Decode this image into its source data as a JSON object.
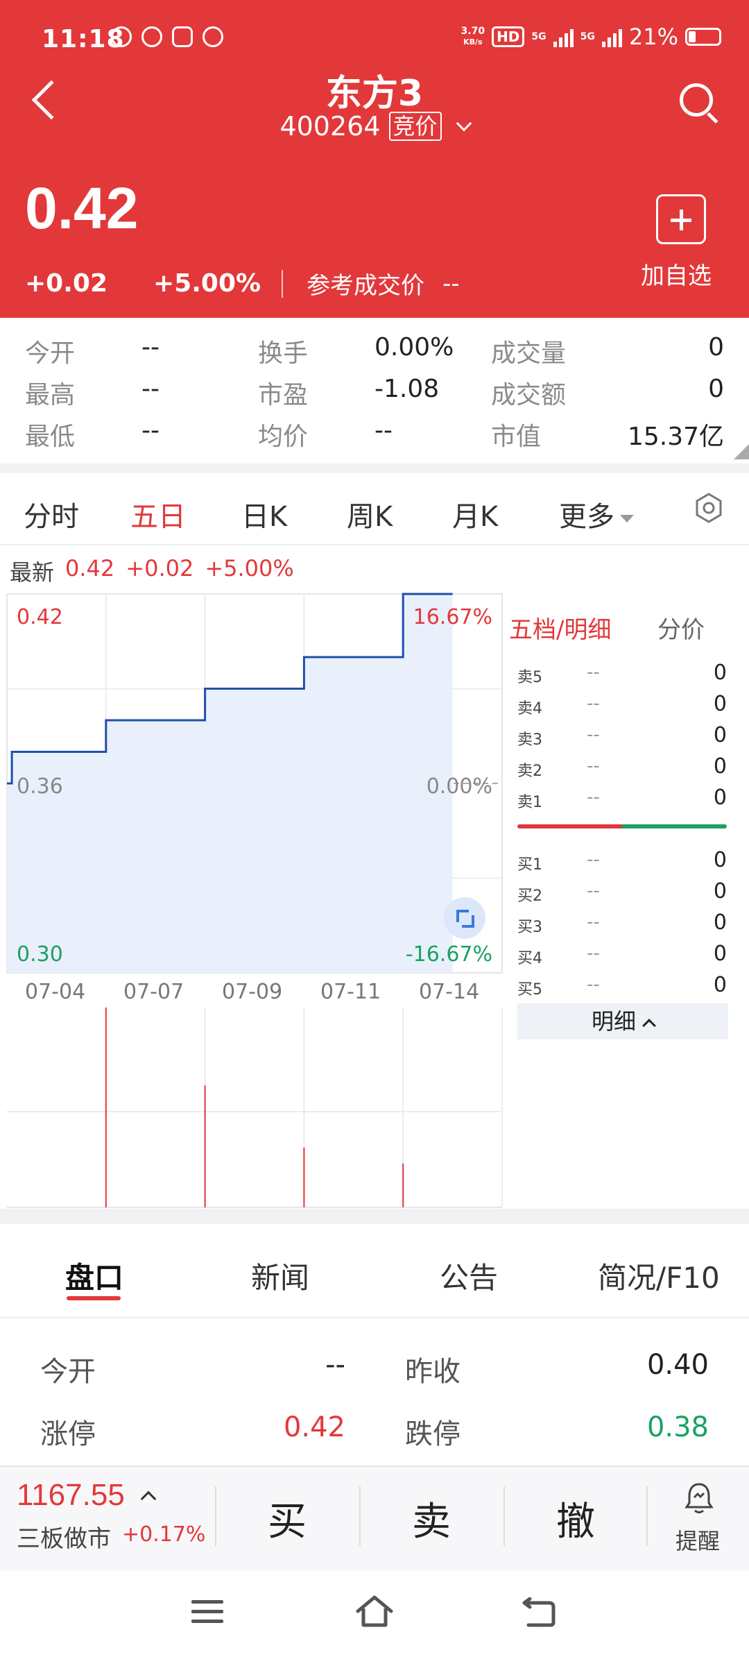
{
  "status_bar": {
    "time": "11:18",
    "net_speed_value": "3.70",
    "net_speed_unit": "KB/s",
    "hd": "HD",
    "signal_1": "5G",
    "signal_2": "5G",
    "battery": "21%"
  },
  "header": {
    "stock_name": "东方3",
    "stock_code": "400264",
    "code_badge": "竞价",
    "price": "0.42",
    "change": "+0.02",
    "change_pct": "+5.00%",
    "ref_label": "参考成交价",
    "ref_value": "--",
    "add_watch_label": "加自选",
    "colors": {
      "header_bg": "#e2383a",
      "up": "#e2383a",
      "down": "#1aa261"
    }
  },
  "stats": [
    {
      "label": "今开",
      "value": "--"
    },
    {
      "label": "换手",
      "value": "0.00%"
    },
    {
      "label": "成交量",
      "value": "0"
    },
    {
      "label": "最高",
      "value": "--"
    },
    {
      "label": "市盈",
      "value": "-1.08"
    },
    {
      "label": "成交额",
      "value": "0"
    },
    {
      "label": "最低",
      "value": "--"
    },
    {
      "label": "均价",
      "value": "--"
    },
    {
      "label": "市值",
      "value": "15.37亿"
    }
  ],
  "chart_tabs": [
    {
      "label": "分时"
    },
    {
      "label": "五日"
    },
    {
      "label": "日K"
    },
    {
      "label": "周K"
    },
    {
      "label": "月K"
    },
    {
      "label": "更多"
    }
  ],
  "active_chart_tab": "五日",
  "latest": {
    "label": "最新",
    "price": "0.42",
    "change": "+0.02",
    "pct": "+5.00%"
  },
  "chart_data": {
    "type": "line",
    "series": [
      {
        "values": [
          0.36,
          0.36,
          0.37,
          0.37,
          0.38,
          0.38,
          0.39,
          0.39,
          0.4,
          0.4,
          0.42,
          0.42
        ]
      }
    ],
    "x": [
      0,
      0.05,
      0.05,
      1,
      1,
      2,
      2,
      3,
      3,
      4,
      4,
      4.5
    ],
    "dates": [
      "07-04",
      "07-07",
      "07-09",
      "07-11",
      "07-14"
    ],
    "y_left_labels": {
      "top": "0.42",
      "mid": "0.36",
      "bottom": "0.30"
    },
    "y_right_labels": {
      "top": "16.67%",
      "mid": "0.00%",
      "bottom": "-16.67%"
    },
    "ylim": [
      0.3,
      0.42
    ],
    "volume": [
      {
        "day": 1,
        "rel": 1.0
      },
      {
        "day": 2,
        "rel": 0.61
      },
      {
        "day": 3,
        "rel": 0.3
      },
      {
        "day": 4,
        "rel": 0.22
      }
    ],
    "grid": true,
    "line_color": "#1f4fa8",
    "fill_color": "#e9f0fb"
  },
  "order_book": {
    "tab_active": "五档/明细",
    "tab_other": "分价",
    "asks": [
      {
        "label": "卖5",
        "price": "--",
        "vol": "0"
      },
      {
        "label": "卖4",
        "price": "--",
        "vol": "0"
      },
      {
        "label": "卖3",
        "price": "--",
        "vol": "0"
      },
      {
        "label": "卖2",
        "price": "--",
        "vol": "0"
      },
      {
        "label": "卖1",
        "price": "--",
        "vol": "0"
      }
    ],
    "bids": [
      {
        "label": "买1",
        "price": "--",
        "vol": "0"
      },
      {
        "label": "买2",
        "price": "--",
        "vol": "0"
      },
      {
        "label": "买3",
        "price": "--",
        "vol": "0"
      },
      {
        "label": "买4",
        "price": "--",
        "vol": "0"
      },
      {
        "label": "买5",
        "price": "--",
        "vol": "0"
      }
    ],
    "detail_button": "明细"
  },
  "info_tabs": [
    {
      "label": "盘口"
    },
    {
      "label": "新闻"
    },
    {
      "label": "公告"
    },
    {
      "label": "简况/F10"
    }
  ],
  "panel": {
    "open_label": "今开",
    "open_value": "--",
    "prev_close_label": "昨收",
    "prev_close_value": "0.40",
    "limit_up_label": "涨停",
    "limit_up_value": "0.42",
    "limit_down_label": "跌停",
    "limit_down_value": "0.38"
  },
  "trade_bar": {
    "index_value": "1167.55",
    "index_name": "三板做市",
    "index_pct": "+0.17%",
    "buy": "买",
    "sell": "卖",
    "cancel": "撤",
    "remind": "提醒"
  }
}
